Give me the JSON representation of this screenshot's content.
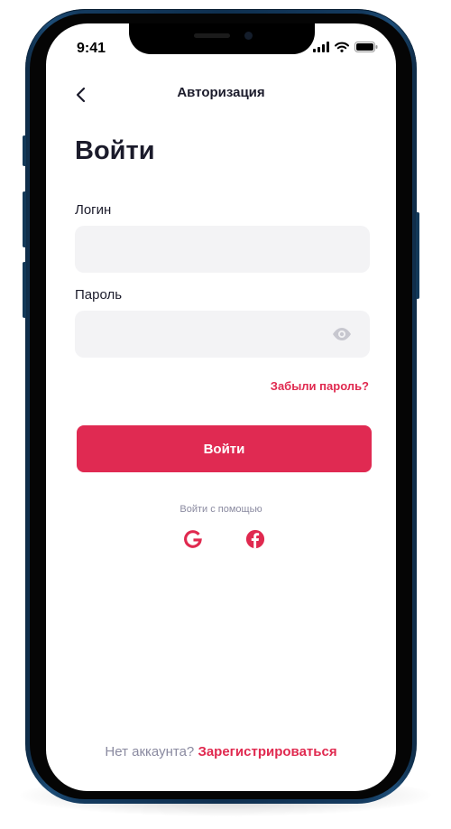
{
  "status_bar": {
    "time": "9:41"
  },
  "nav": {
    "back_icon": "chevron-left-icon",
    "title": "Авторизация"
  },
  "page": {
    "title": "Войти"
  },
  "form": {
    "login_label": "Логин",
    "login_value": "",
    "password_label": "Пароль",
    "password_value": "",
    "password_toggle_icon": "eye-icon",
    "forgot_link": "Забыли пароль?",
    "submit_label": "Войти"
  },
  "social": {
    "caption": "Войти с помощью",
    "providers": [
      {
        "icon": "google-icon",
        "color": "#e0294f"
      },
      {
        "icon": "facebook-icon",
        "color": "#e0294f"
      }
    ]
  },
  "footer": {
    "question": "Нет аккаунта?",
    "register_link": "Зарегистрироваться"
  },
  "colors": {
    "accent": "#e02a52",
    "text": "#1b1b2b",
    "muted": "#8a8aa0",
    "field_bg": "#f3f3f5",
    "frame": "#0f3050"
  }
}
